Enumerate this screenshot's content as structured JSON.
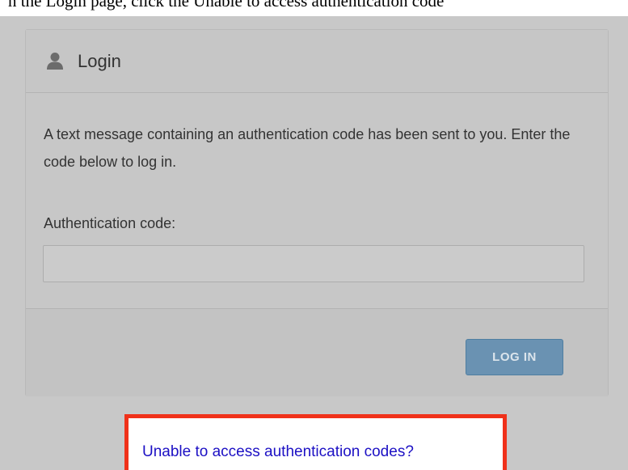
{
  "caption": "n the Login page, click the Unable to access authentication code",
  "panel": {
    "title": "Login",
    "message": "A text message containing an authentication code has been sent to you. Enter the code below to log in.",
    "field_label": "Authentication code:",
    "code_value": "",
    "login_button": "LOG IN"
  },
  "help_link": "Unable to access authentication codes?",
  "colors": {
    "link": "#1c10c4",
    "highlight_border": "#f0311a",
    "button": "#6a92b2"
  },
  "icons": {
    "header": "user-icon"
  }
}
